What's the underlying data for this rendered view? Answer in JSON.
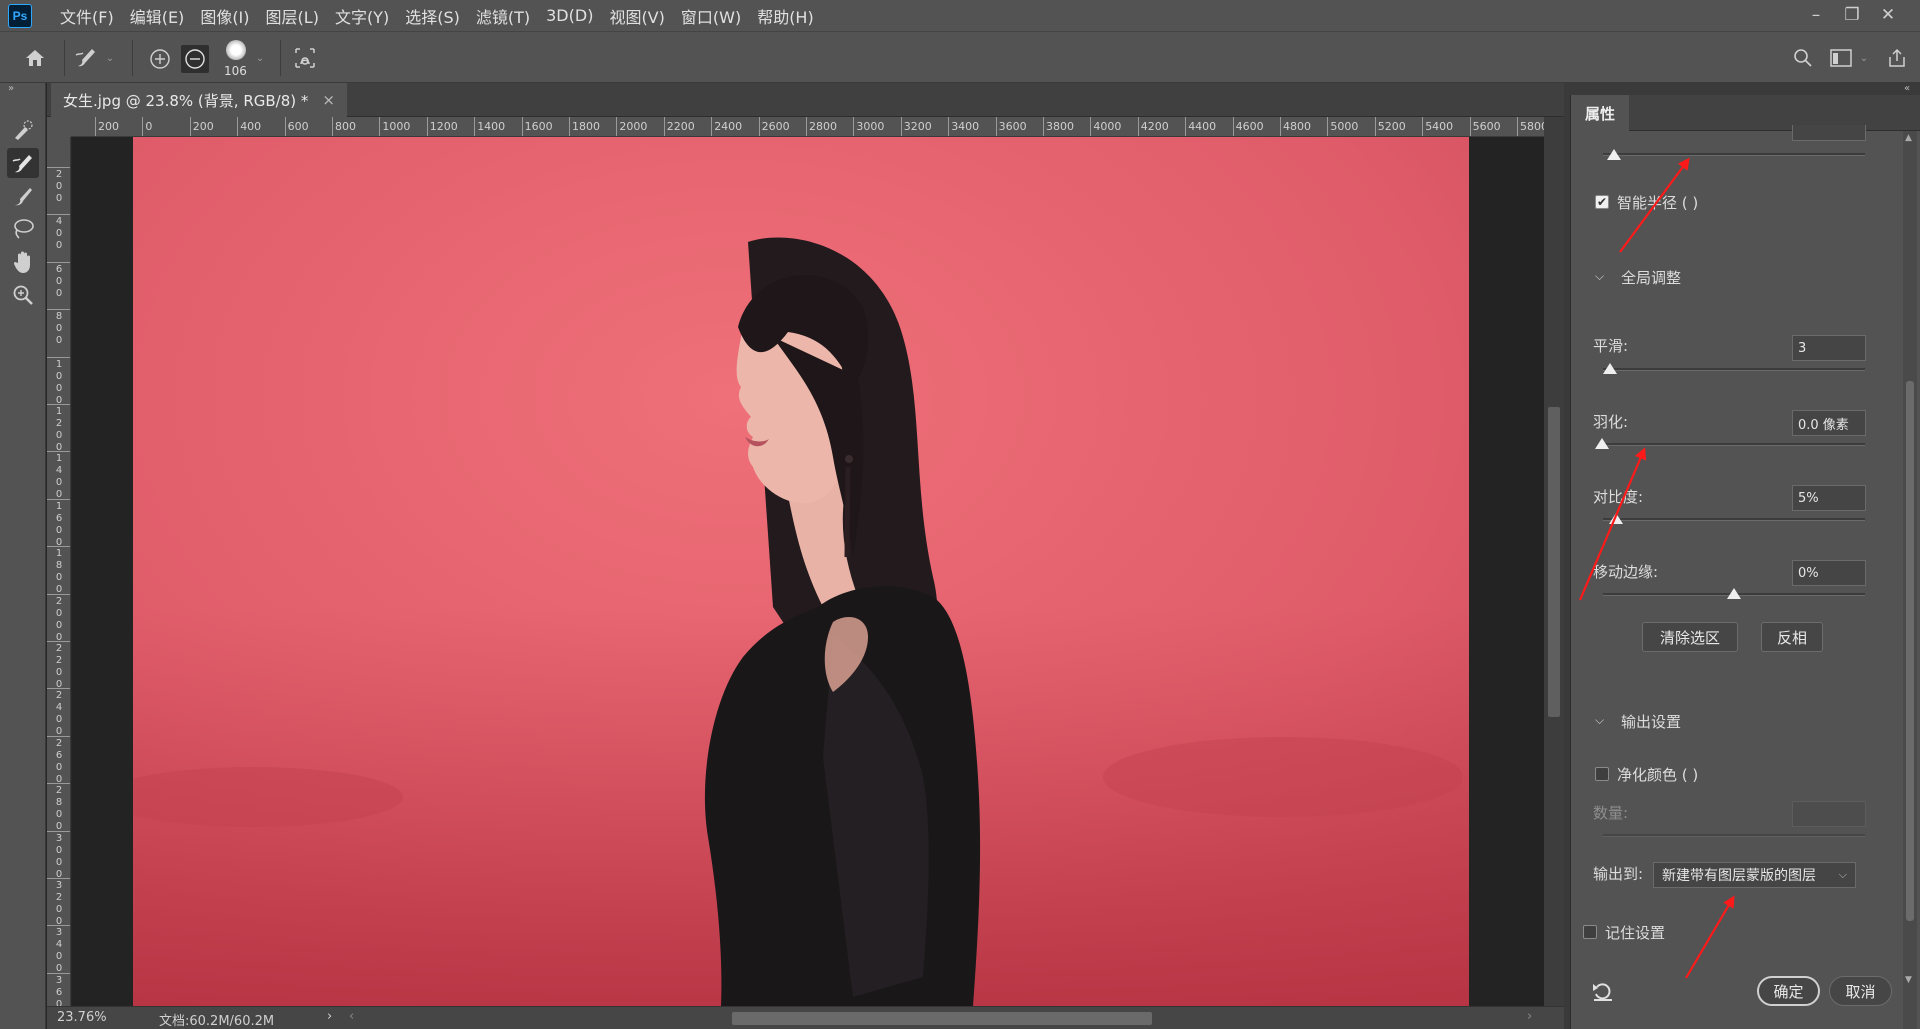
{
  "app": {
    "logo": "Ps"
  },
  "menu": [
    "文件(F)",
    "编辑(E)",
    "图像(I)",
    "图层(L)",
    "文字(Y)",
    "选择(S)",
    "滤镜(T)",
    "3D(D)",
    "视图(V)",
    "窗口(W)",
    "帮助(H)"
  ],
  "options_bar": {
    "brush_size": "106"
  },
  "document": {
    "tab_title": "女生.jpg @ 23.8% (背景, RGB/8) *",
    "close_glyph": "×"
  },
  "ruler": {
    "top_labels": [
      "200",
      "0",
      "200",
      "400",
      "600",
      "800",
      "1000",
      "1200",
      "1400",
      "1600",
      "1800",
      "2000",
      "2200",
      "2400",
      "2600",
      "2800",
      "3000",
      "3200",
      "3400",
      "3600",
      "3800",
      "4000",
      "4200",
      "4400",
      "4600",
      "4800",
      "5000",
      "5200",
      "5400",
      "5600",
      "5800"
    ],
    "left_labels": [
      "2 0 0",
      "4 0 0",
      "6 0 0",
      "8 0 0",
      "1 0 0 0",
      "1 2 0 0",
      "1 4 0 0",
      "1 6 0 0",
      "1 8 0 0",
      "2 0 0 0",
      "2 2 0 0",
      "2 4 0 0",
      "2 6 0 0",
      "2 8 0 0",
      "3 0 0 0",
      "3 2 0 0",
      "3 4 0 0",
      "3 6 0 0"
    ]
  },
  "status": {
    "zoom": "23.76%",
    "doc_size": "文档:60.2M/60.2M",
    "arrow": "›"
  },
  "panel": {
    "tab": "属性",
    "smart_radius": {
      "label": "智能半径 ( )",
      "checked": true
    },
    "global": {
      "title": "全局调整",
      "smooth": {
        "label": "平滑:",
        "value": "3",
        "level": 0
      },
      "feather": {
        "label": "羽化:",
        "value": "0.0 像素",
        "level": 0
      },
      "contrast": {
        "label": "对比度:",
        "value": "5%",
        "level": 5
      },
      "shift_edge": {
        "label": "移动边缘:",
        "value": "0%",
        "level": 0
      }
    },
    "buttons": {
      "clear": "清除选区",
      "invert": "反相"
    },
    "output": {
      "title": "输出设置",
      "decontaminate": {
        "label": "净化颜色 ( )",
        "checked": false
      },
      "amount_label": "数量:",
      "output_to_label": "输出到:",
      "output_to_value": "新建带有图层蒙版的图层"
    },
    "remember": {
      "label": "记住设置",
      "checked": false
    },
    "ok": "确定",
    "cancel": "取消"
  },
  "colors": {
    "background": "#e55f6e",
    "chrome": "#535353",
    "annotation": "#ff0000"
  },
  "icons": {
    "home": "home-icon",
    "brush": "refine-edge-brush-icon",
    "add": "add-to-selection-icon",
    "subtract": "subtract-from-selection-icon",
    "search": "search-icon",
    "reset": "reset-icon"
  }
}
